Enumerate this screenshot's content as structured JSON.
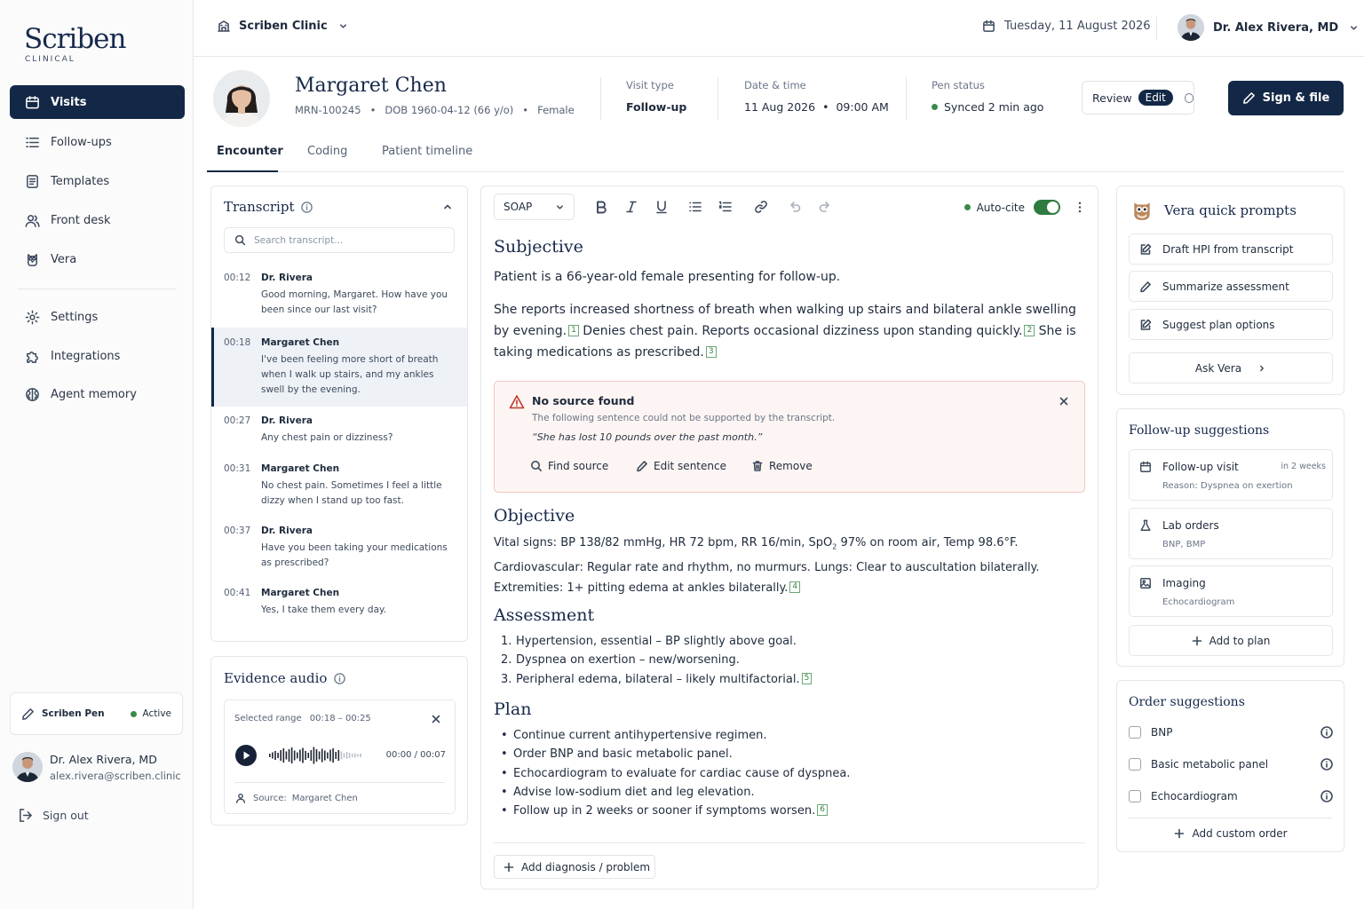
{
  "sidebar": {
    "logo": "Scriben",
    "logo_sub": "CLINICAL",
    "nav": [
      {
        "label": "Visits",
        "icon": "calendar-icon"
      },
      {
        "label": "Follow-ups",
        "icon": "list-icon"
      },
      {
        "label": "Templates",
        "icon": "document-icon"
      },
      {
        "label": "Front desk",
        "icon": "users-icon"
      },
      {
        "label": "Vera",
        "icon": "owl-icon"
      },
      {
        "label": "Settings",
        "icon": "gear-icon"
      },
      {
        "label": "Integrations",
        "icon": "puzzle-icon"
      },
      {
        "label": "Agent memory",
        "icon": "brain-icon"
      }
    ],
    "pen": {
      "label": "Scriben Pen",
      "status": "Active"
    },
    "user": {
      "name": "Dr. Alex Rivera, MD",
      "email": "alex.rivera@scriben.clinic"
    },
    "signout": "Sign out"
  },
  "topbar": {
    "clinic": "Scriben Clinic",
    "date": "Tuesday, 11 August 2026",
    "doctor": "Dr. Alex Rivera, MD"
  },
  "patient": {
    "name": "Margaret Chen",
    "mrn": "MRN-100245",
    "dob": "DOB 1960-04-12 (66 y/o)",
    "sex": "Female",
    "visit_type_label": "Visit type",
    "visit_type": "Follow-up",
    "datetime_label": "Date & time",
    "date": "11 Aug 2026",
    "time": "09:00 AM",
    "pen_label": "Pen status",
    "pen_status": "Synced 2 min ago"
  },
  "actions": {
    "review": "Review",
    "edit": "Edit",
    "sign": "Sign & file"
  },
  "tabs": [
    "Encounter",
    "Coding",
    "Patient timeline"
  ],
  "transcript": {
    "title": "Transcript",
    "search_placeholder": "Search transcript...",
    "lines": [
      {
        "time": "00:12",
        "speaker": "Dr. Rivera",
        "text": "Good morning, Margaret. How have you been since our last visit?"
      },
      {
        "time": "00:18",
        "speaker": "Margaret Chen",
        "text": "I've been feeling more short of breath when I walk up stairs, and my ankles swell by the evening."
      },
      {
        "time": "00:27",
        "speaker": "Dr. Rivera",
        "text": "Any chest pain or dizziness?"
      },
      {
        "time": "00:31",
        "speaker": "Margaret Chen",
        "text": "No chest pain. Sometimes I feel a little dizzy when I stand up too fast."
      },
      {
        "time": "00:37",
        "speaker": "Dr. Rivera",
        "text": "Have you been taking your medications as prescribed?"
      },
      {
        "time": "00:41",
        "speaker": "Margaret Chen",
        "text": "Yes, I take them every day."
      }
    ]
  },
  "audio": {
    "title": "Evidence audio",
    "range_label": "Selected range",
    "range": "00:18 – 00:25",
    "time": "00:00 / 00:07",
    "source_label": "Source:",
    "source": "Margaret Chen"
  },
  "editor": {
    "template": "SOAP",
    "autocite": "Auto-cite",
    "subjective_title": "Subjective",
    "subjective_1": "Patient is a 66-year-old female presenting for follow-up.",
    "subjective_2a": "She reports increased shortness of breath when walking up stairs and bilateral ankle swelling by evening.",
    "subjective_2b": "Denies chest pain. Reports occasional dizziness upon standing quickly.",
    "subjective_2c": "She is taking medications as prescribed.",
    "alert": {
      "title": "No source found",
      "desc": "The following sentence could not be supported by the transcript.",
      "quote": "“She has lost 10 pounds over the past month.”",
      "find": "Find source",
      "edit": "Edit sentence",
      "remove": "Remove"
    },
    "objective_title": "Objective",
    "objective_1a": "Vital signs: BP 138/82 mmHg, HR 72 bpm, RR 16/min, SpO",
    "objective_1sub": "2",
    "objective_1b": " 97% on room air, Temp 98.6°F.",
    "objective_2": "Cardiovascular: Regular rate and rhythm, no murmurs. Lungs: Clear to auscultation bilaterally.",
    "objective_3": "Extremities: 1+ pitting edema at ankles bilaterally.",
    "assessment_title": "Assessment",
    "assessment": [
      "Hypertension, essential – BP slightly above goal.",
      "Dyspnea on exertion – new/worsening.",
      "Peripheral edema, bilateral – likely multifactorial."
    ],
    "plan_title": "Plan",
    "plan": [
      "Continue current antihypertensive regimen.",
      "Order BNP and basic metabolic panel.",
      "Echocardiogram to evaluate for cardiac cause of dyspnea.",
      "Advise low-sodium diet and leg elevation.",
      "Follow up in 2 weeks or sooner if symptoms worsen."
    ],
    "citations": [
      "1",
      "2",
      "3",
      "4",
      "5",
      "6"
    ],
    "add_dx": "Add diagnosis / problem"
  },
  "vera": {
    "title": "Vera quick prompts",
    "prompts": [
      "Draft HPI from transcript",
      "Summarize assessment",
      "Suggest plan options"
    ],
    "ask": "Ask Vera"
  },
  "followups": {
    "title": "Follow-up suggestions",
    "items": [
      {
        "title": "Follow-up visit",
        "meta": "in 2 weeks",
        "sub": "Reason: Dyspnea on exertion",
        "icon": "calendar-icon"
      },
      {
        "title": "Lab orders",
        "sub": "BNP, BMP",
        "icon": "flask-icon"
      },
      {
        "title": "Imaging",
        "sub": "Echocardiogram",
        "icon": "image-icon"
      }
    ],
    "add": "Add to plan"
  },
  "orders": {
    "title": "Order suggestions",
    "items": [
      "BNP",
      "Basic metabolic panel",
      "Echocardiogram"
    ],
    "add": "Add custom order"
  },
  "colors": {
    "navy": "#132846",
    "green": "#2f7a3f",
    "alert_bg": "#fdf5f3",
    "alert_red": "#c0392b"
  }
}
